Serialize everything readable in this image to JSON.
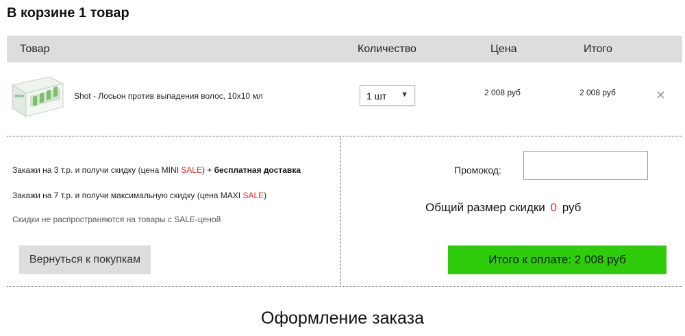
{
  "cart": {
    "title": "В корзине 1 товар"
  },
  "table": {
    "headers": {
      "product": "Товар",
      "quantity": "Количество",
      "price": "Цена",
      "total": "Итого"
    },
    "rows": [
      {
        "name": "Shot - Лосьон против выпадения волос, 10x10 мл",
        "quantity": "1 шт",
        "price": "2 008 руб",
        "total": "2 008 руб"
      }
    ]
  },
  "promo_info": {
    "line1_start": "Закажи на 3 т.р. и получи скидку (цена MINI ",
    "line1_sale": "SALE",
    "line1_mid": ") + ",
    "line1_bold": "бесплатная доставка",
    "line2_start": "Закажи на 7 т.р. и получи максимальную скидку (цена MAXI ",
    "line2_sale": "SALE",
    "line2_end": ")",
    "note": "Скидки не распространяются на товары с SALE-ценой"
  },
  "actions": {
    "back_label": "Вернуться к покупкам",
    "pay_label": "Итого к оплате: 2 008 руб"
  },
  "promocode": {
    "label": "Промокод:",
    "value": "",
    "placeholder": ""
  },
  "discount": {
    "label_start": "Общий размер скидки",
    "amount": "0",
    "currency": "руб"
  },
  "checkout": {
    "title": "Оформление заказа"
  },
  "icons": {
    "remove": "close-icon",
    "dropdown": "chevron-down-icon"
  },
  "colors": {
    "header_bg": "#dddddd",
    "sale_red": "#e8282c",
    "pay_green": "#2ecc0a",
    "back_button_bg": "#dddddd"
  }
}
